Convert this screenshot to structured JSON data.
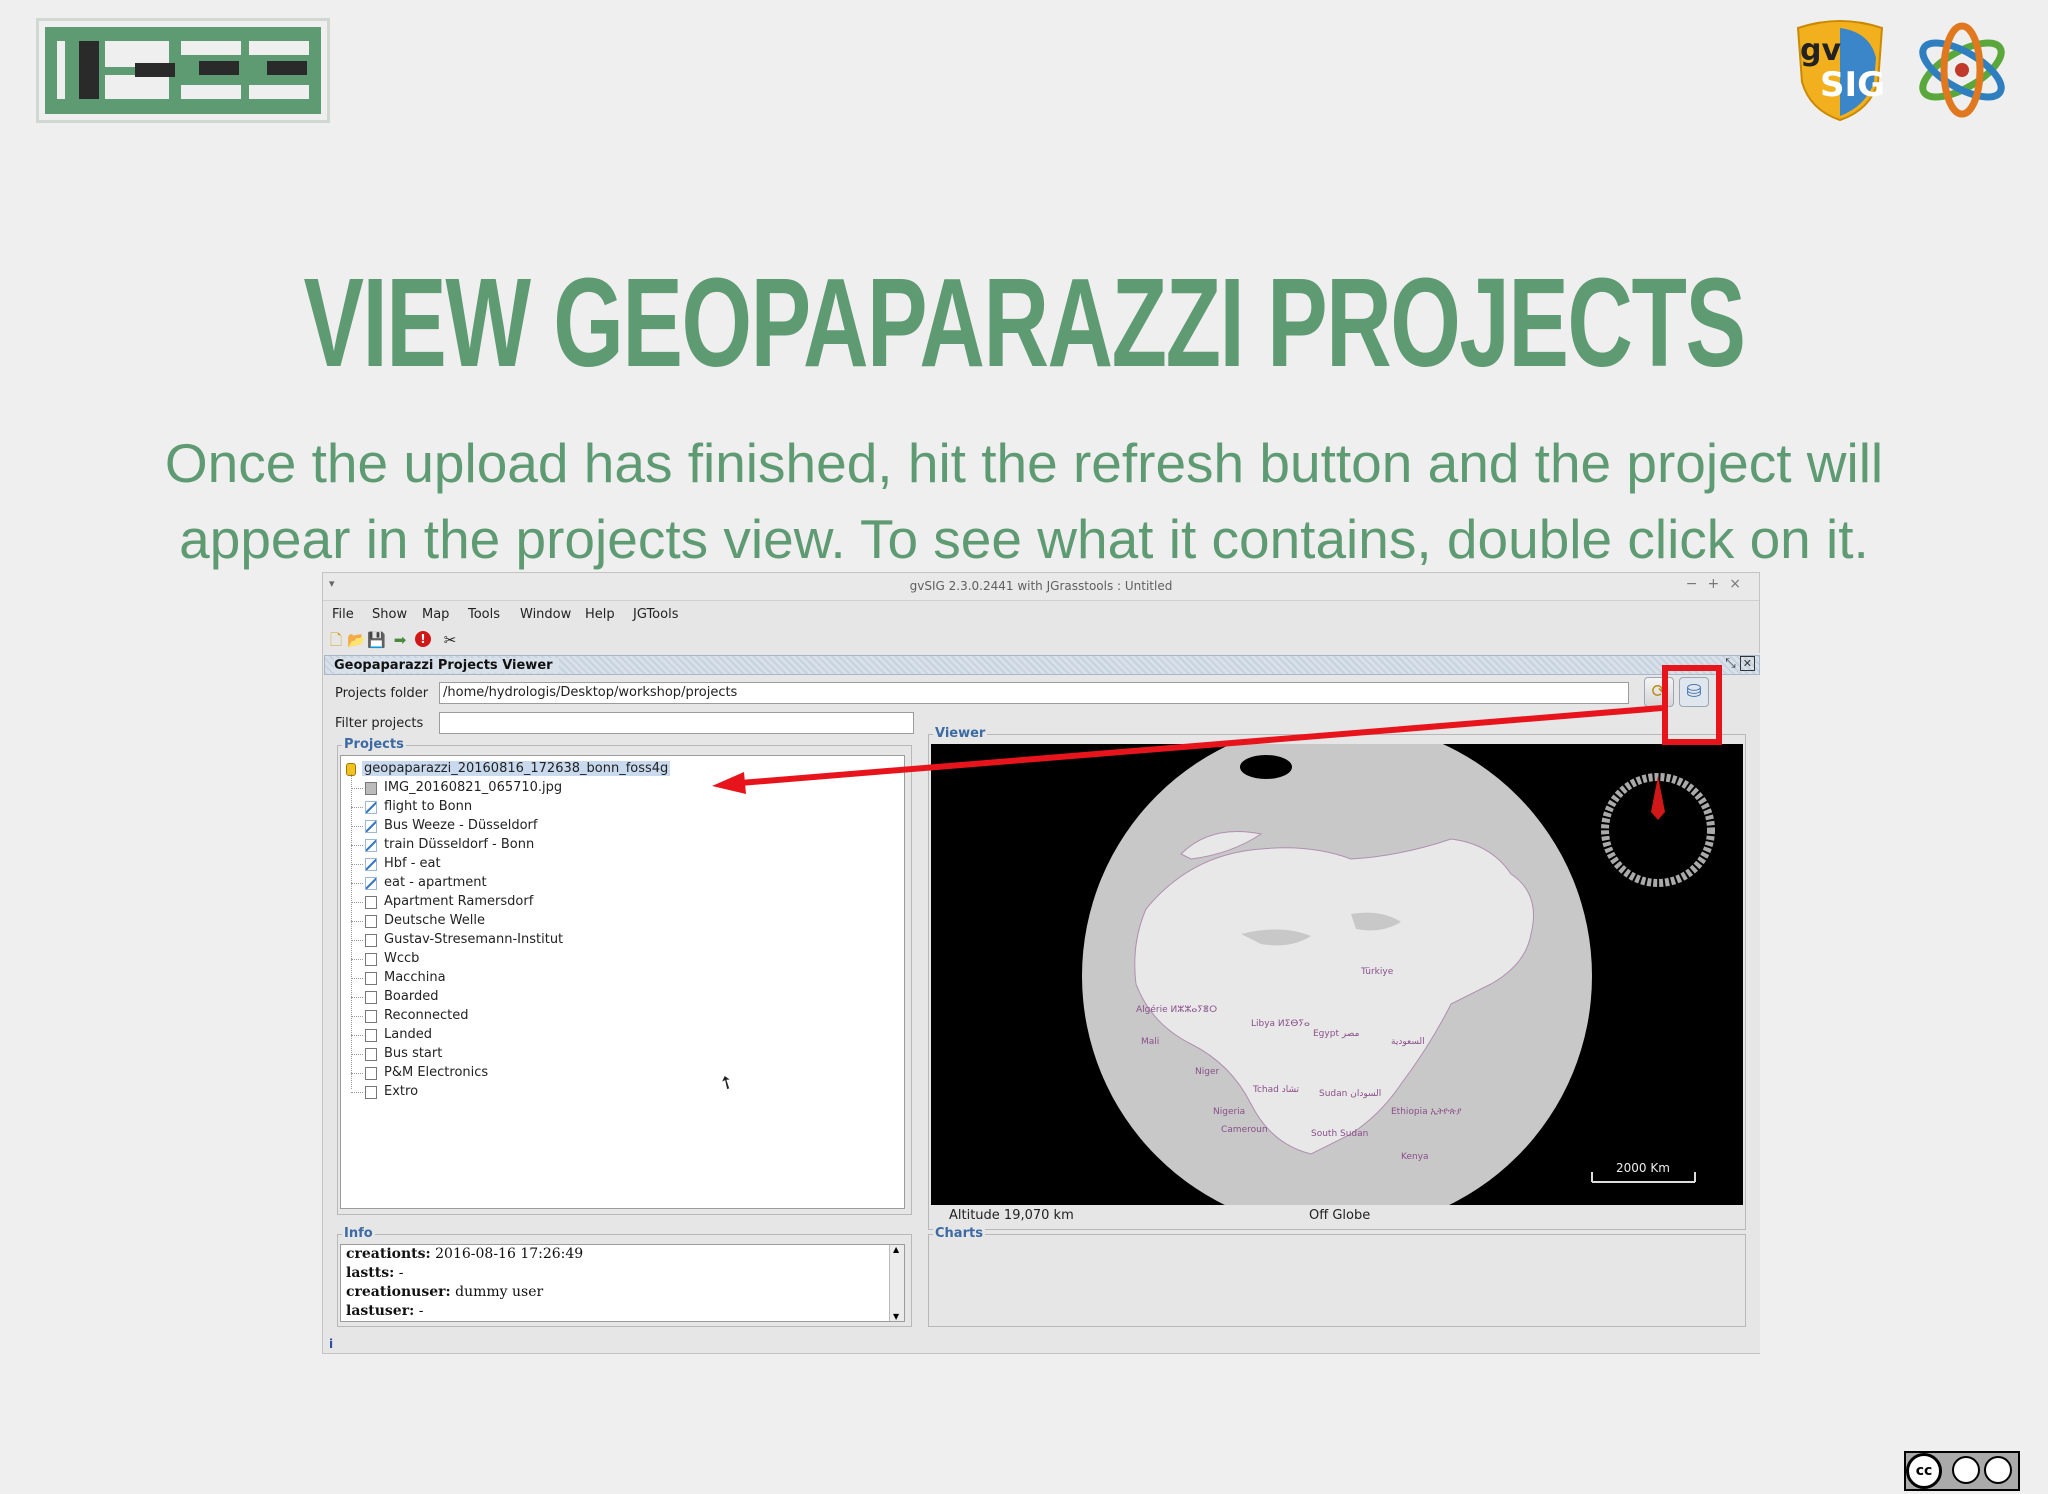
{
  "slide": {
    "title": "VIEW GEOPAPARAZZI PROJECTS",
    "subtitle_line1": "Once the upload has finished, hit the refresh button and the project will",
    "subtitle_line2": "appear in the projects view. To see what it contains, double click on it."
  },
  "logos": {
    "gvsig_text_top": "gv",
    "gvsig_text_bottom": "SIG"
  },
  "window": {
    "title": "gvSIG 2.3.0.2441 with JGrasstools : Untitled",
    "menu": [
      "File",
      "Show",
      "Map",
      "Tools",
      "Window",
      "Help",
      "JGTools"
    ]
  },
  "toolbar": {
    "icons": [
      "new-document-icon",
      "open-folder-icon",
      "save-icon",
      "export-icon",
      "error-icon",
      "tools-icon"
    ]
  },
  "viewer": {
    "frame_title": "Geopaparazzi Projects Viewer",
    "projects_folder_label": "Projects folder",
    "projects_folder_value": "/home/hydrologis/Desktop/workshop/projects",
    "filter_label": "Filter projects",
    "filter_value": "",
    "projects_group": "Projects",
    "viewer_group": "Viewer",
    "info_group": "Info",
    "charts_group": "Charts",
    "tree": {
      "root": "geopaparazzi_20160816_172638_bonn_foss4g",
      "children": [
        {
          "label": "IMG_20160821_065710.jpg",
          "type": "image"
        },
        {
          "label": "flight to Bonn",
          "type": "track"
        },
        {
          "label": "Bus Weeze - Düsseldorf",
          "type": "track"
        },
        {
          "label": "train Düsseldorf - Bonn",
          "type": "track"
        },
        {
          "label": "Hbf - eat",
          "type": "track"
        },
        {
          "label": "eat - apartment",
          "type": "track"
        },
        {
          "label": "Apartment Ramersdorf",
          "type": "note"
        },
        {
          "label": "Deutsche Welle",
          "type": "note"
        },
        {
          "label": "Gustav-Stresemann-Institut",
          "type": "note"
        },
        {
          "label": "Wccb",
          "type": "note"
        },
        {
          "label": "Macchina",
          "type": "note"
        },
        {
          "label": "Boarded",
          "type": "note"
        },
        {
          "label": "Reconnected",
          "type": "note"
        },
        {
          "label": "Landed",
          "type": "note"
        },
        {
          "label": "Bus start",
          "type": "note"
        },
        {
          "label": "P&M Electronics",
          "type": "note"
        },
        {
          "label": "Extro",
          "type": "note"
        }
      ]
    },
    "map": {
      "scale_label": "2000 Km",
      "altitude": "Altitude  19,070 km",
      "globe_mode": "Off Globe",
      "countries": [
        "Türkiye",
        "Libya ⵍⵉⴱⵢⴰ",
        "Egypt مصر",
        "Sudan السودان",
        "Tchad تشاد",
        "Niger",
        "Nigeria",
        "Kenya",
        "Algérie ⵍⵣⵣⴰⵢⴻⵔ",
        "South Sudan",
        "Cameroun",
        "Mali",
        "Ethiopia ኢትዮጵያ",
        "السعودية"
      ]
    },
    "info": {
      "creationts_key": "creationts:",
      "creationts_value": " 2016-08-16 17:26:49",
      "lastts_key": "lastts:",
      "lastts_value": " -",
      "creationuser_key": "creationuser:",
      "creationuser_value": " dummy user",
      "lastuser_key": "lastuser:",
      "lastuser_value": " -"
    },
    "statusbar": "i"
  },
  "colors": {
    "title_green": "#5e9b73",
    "annotation_red": "#e8141c",
    "group_title_blue": "#3d6aa3"
  }
}
